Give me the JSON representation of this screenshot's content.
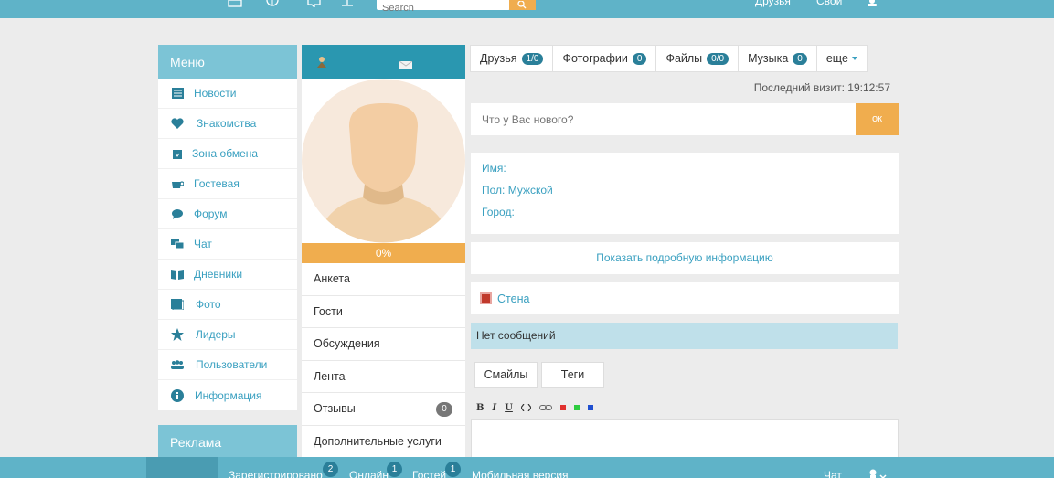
{
  "topbar": {
    "search_placeholder": "Search",
    "friends_label": "Друзья",
    "right_text": "Свой"
  },
  "menu": {
    "title": "Меню",
    "items": [
      {
        "label": "Новости",
        "icon": "news-icon"
      },
      {
        "label": "Знакомства",
        "icon": "heart-icon"
      },
      {
        "label": "Зона обмена",
        "icon": "download-box-icon"
      },
      {
        "label": "Гостевая",
        "icon": "cup-icon"
      },
      {
        "label": "Форум",
        "icon": "comment-icon"
      },
      {
        "label": "Чат",
        "icon": "chat-icon"
      },
      {
        "label": "Дневники",
        "icon": "book-icon"
      },
      {
        "label": "Фото",
        "icon": "photo-icon"
      },
      {
        "label": "Лидеры",
        "icon": "star-icon"
      },
      {
        "label": "Пользователи",
        "icon": "users-icon"
      },
      {
        "label": "Информация",
        "icon": "info-icon"
      }
    ],
    "ad_title": "Реклама"
  },
  "profile": {
    "progress": "0%",
    "progress_value": 0,
    "items": [
      "Анкета",
      "Гости",
      "Обсуждения",
      "Лента",
      "Отзывы",
      "Дополнительные услуги"
    ],
    "reviews_count": "0"
  },
  "tabs": [
    {
      "label": "Друзья",
      "count": "1/0"
    },
    {
      "label": "Фотографии",
      "count": "0"
    },
    {
      "label": "Файлы",
      "count": "0/0"
    },
    {
      "label": "Музыка",
      "count": "0"
    },
    {
      "label": "еще",
      "count": null
    }
  ],
  "last_visit": "Последний визит: 19:12:57",
  "status": {
    "placeholder": "Что у Вас нового?",
    "ok_label": "ок"
  },
  "info": {
    "name": "Имя:",
    "gender": "Пол: Мужской",
    "city": "Город:",
    "more_label": "Показать подробную информацию"
  },
  "wall": {
    "title": "Стена",
    "no_messages": "Нет сообщений",
    "smiles_label": "Смайлы",
    "tags_label": "Теги",
    "toolbar": [
      "B",
      "I",
      "U"
    ]
  },
  "bottombar": {
    "registered_label": "Зарегистрировано",
    "registered_count": "2",
    "online_label": "Онлайн",
    "online_count": "1",
    "guests_label": "Гостей",
    "guests_count": "1",
    "mobile_label": "Мобильная версия",
    "chat_label": "Чат"
  },
  "colors": {
    "accent": "#5fb3c8",
    "orange": "#f0ad4e",
    "link": "#3aa0c0",
    "dark_teal": "#2a97b0"
  }
}
